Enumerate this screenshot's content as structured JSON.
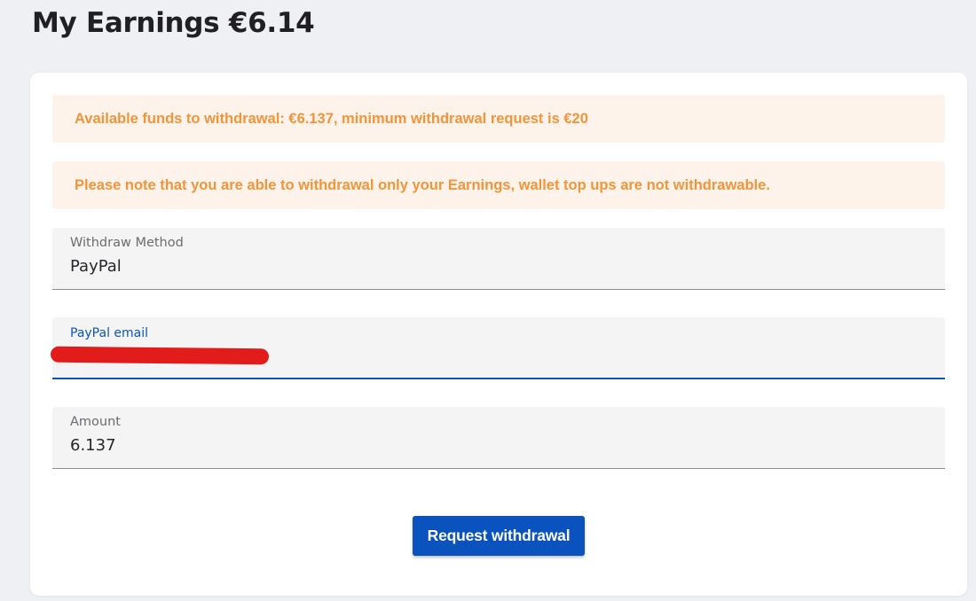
{
  "header": {
    "title": "My Earnings €6.14"
  },
  "alerts": {
    "funds": "Available funds to withdrawal: €6.137, minimum withdrawal request is €20",
    "note": "Please note that you are able to withdrawal only your Earnings, wallet top ups are not withdrawable."
  },
  "form": {
    "method": {
      "label": "Withdraw Method",
      "value": "PayPal"
    },
    "email": {
      "label": "PayPal email",
      "value": ""
    },
    "amount": {
      "label": "Amount",
      "value": "6.137"
    },
    "submit_label": "Request withdrawal"
  },
  "colors": {
    "alert_bg": "#fef3eb",
    "alert_text": "#f0953a",
    "accent": "#0b56b8",
    "button_bg": "#0a53be",
    "redaction": "#e21b1b"
  }
}
